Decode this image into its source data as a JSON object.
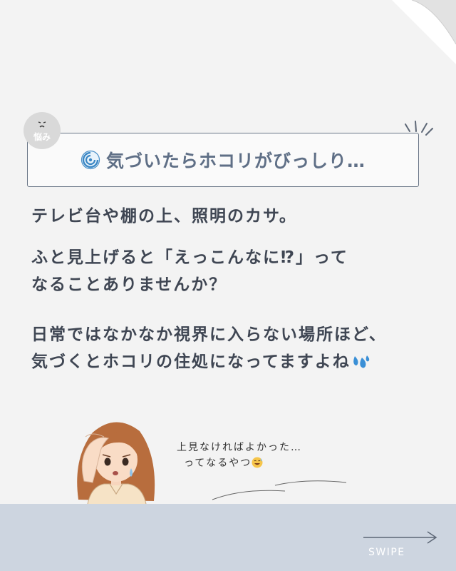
{
  "badge": {
    "face": "^^",
    "label": "悩み"
  },
  "title": {
    "text": "気づいたらホコリがびっしり…",
    "icon": "cyclone-icon"
  },
  "paragraphs": {
    "p1_l1": "テレビ台や棚の上、照明のカサ。",
    "p2_l1": "ふと見上げると「えっこんなに⁉」って",
    "p2_l2": " なることありませんか？",
    "p3_l1": "日常ではなかなか視界に入らない場所ほど、",
    "p3_l2": " 気づくとホコリの住処になってますよね"
  },
  "bubble": {
    "line1": "上見なければよかった…",
    "line2": "ってなるやつ"
  },
  "footer": {
    "swipe": "SWIPE"
  },
  "colors": {
    "background": "#f3f3f3",
    "title": "#5f6f86",
    "text": "#3f4653",
    "footer": "#cdd5e0",
    "badge": "#d9d9d9"
  }
}
